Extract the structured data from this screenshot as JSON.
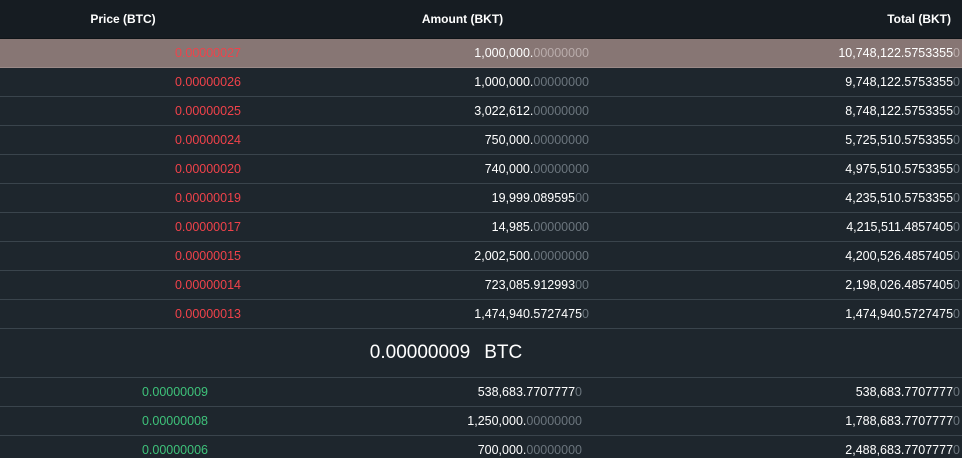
{
  "header": {
    "price_label": "Price (BTC)",
    "amount_label": "Amount (BKT)",
    "total_label": "Total (BKT)"
  },
  "asks": [
    {
      "price": "0.00000027",
      "amount_main": "1,000,000.",
      "amount_dim": "00000000",
      "total_main": "10,748,122.5753355",
      "total_dim": "0"
    },
    {
      "price": "0.00000026",
      "amount_main": "1,000,000.",
      "amount_dim": "00000000",
      "total_main": "9,748,122.5753355",
      "total_dim": "0"
    },
    {
      "price": "0.00000025",
      "amount_main": "3,022,612.",
      "amount_dim": "00000000",
      "total_main": "8,748,122.5753355",
      "total_dim": "0"
    },
    {
      "price": "0.00000024",
      "amount_main": "750,000.",
      "amount_dim": "00000000",
      "total_main": "5,725,510.5753355",
      "total_dim": "0"
    },
    {
      "price": "0.00000020",
      "amount_main": "740,000.",
      "amount_dim": "00000000",
      "total_main": "4,975,510.5753355",
      "total_dim": "0"
    },
    {
      "price": "0.00000019",
      "amount_main": "19,999.089595",
      "amount_dim": "00",
      "total_main": "4,235,510.5753355",
      "total_dim": "0"
    },
    {
      "price": "0.00000017",
      "amount_main": "14,985.",
      "amount_dim": "00000000",
      "total_main": "4,215,511.4857405",
      "total_dim": "0"
    },
    {
      "price": "0.00000015",
      "amount_main": "2,002,500.",
      "amount_dim": "00000000",
      "total_main": "4,200,526.4857405",
      "total_dim": "0"
    },
    {
      "price": "0.00000014",
      "amount_main": "723,085.912993",
      "amount_dim": "00",
      "total_main": "2,198,026.4857405",
      "total_dim": "0"
    },
    {
      "price": "0.00000013",
      "amount_main": "1,474,940.5727475",
      "amount_dim": "0",
      "total_main": "1,474,940.5727475",
      "total_dim": "0"
    }
  ],
  "last_price": {
    "value": "0.00000009",
    "unit": "BTC"
  },
  "bids": [
    {
      "price": "0.00000009",
      "amount_main": "538,683.7707777",
      "amount_dim": "0",
      "total_main": "538,683.7707777",
      "total_dim": "0"
    },
    {
      "price": "0.00000008",
      "amount_main": "1,250,000.",
      "amount_dim": "00000000",
      "total_main": "1,788,683.7707777",
      "total_dim": "0"
    },
    {
      "price": "0.00000006",
      "amount_main": "700,000.",
      "amount_dim": "00000000",
      "total_main": "2,488,683.7707777",
      "total_dim": "0"
    }
  ],
  "colors": {
    "ask_price": "#f0424a",
    "bid_price": "#3ec27a",
    "highlight_row": "#877674",
    "background": "#1e262d"
  }
}
